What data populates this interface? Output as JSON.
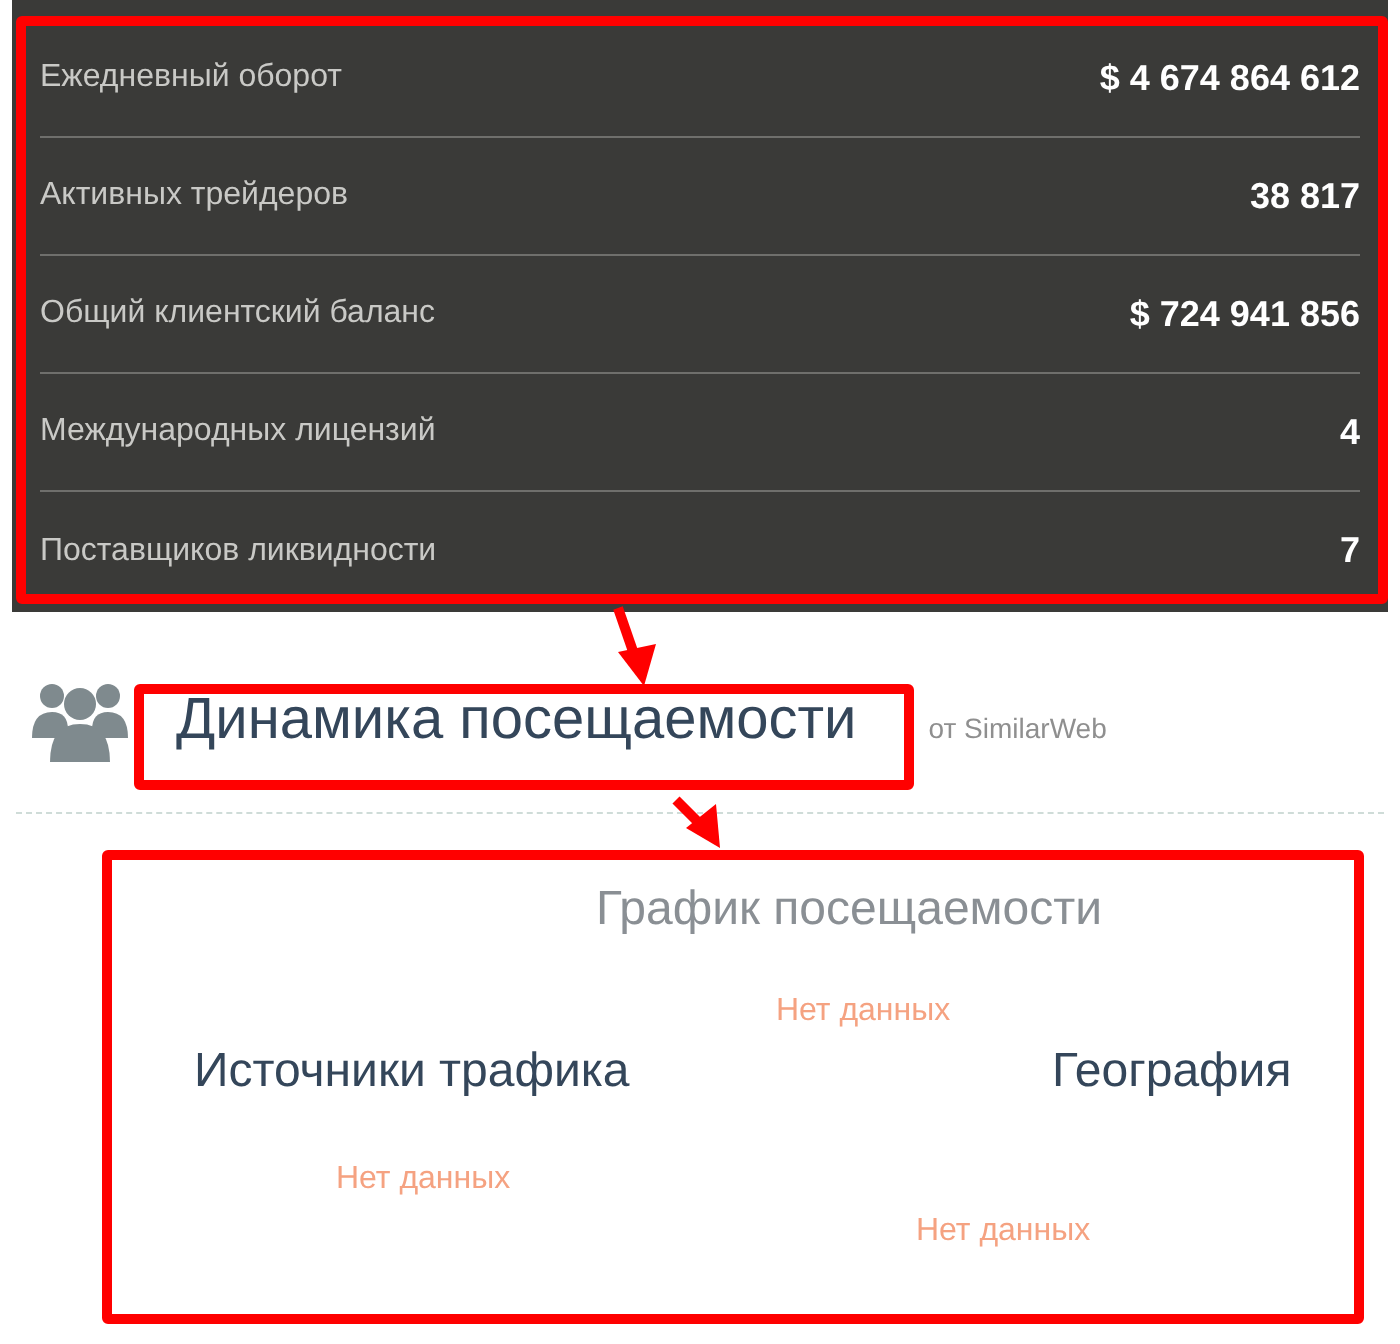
{
  "stats": [
    {
      "label": "Ежедневный оборот",
      "value": "$ 4 674 864 612"
    },
    {
      "label": "Активных трейдеров",
      "value": "38 817"
    },
    {
      "label": "Общий клиентский баланс",
      "value": "$ 724 941 856"
    },
    {
      "label": "Международных лицензий",
      "value": "4"
    },
    {
      "label": "Поставщиков ликвидности",
      "value": "7"
    }
  ],
  "section": {
    "title": "Динамика посещаемости",
    "source": "от SimilarWeb"
  },
  "widgets": [
    {
      "kind": "subtitle",
      "text": "График посещаемости"
    },
    {
      "kind": "empty",
      "text": "Нет данных"
    },
    {
      "kind": "heading",
      "text": "Источники трафика"
    },
    {
      "kind": "heading",
      "text": "География"
    },
    {
      "kind": "empty",
      "text": "Нет данных"
    },
    {
      "kind": "empty",
      "text": "Нет данных"
    }
  ]
}
